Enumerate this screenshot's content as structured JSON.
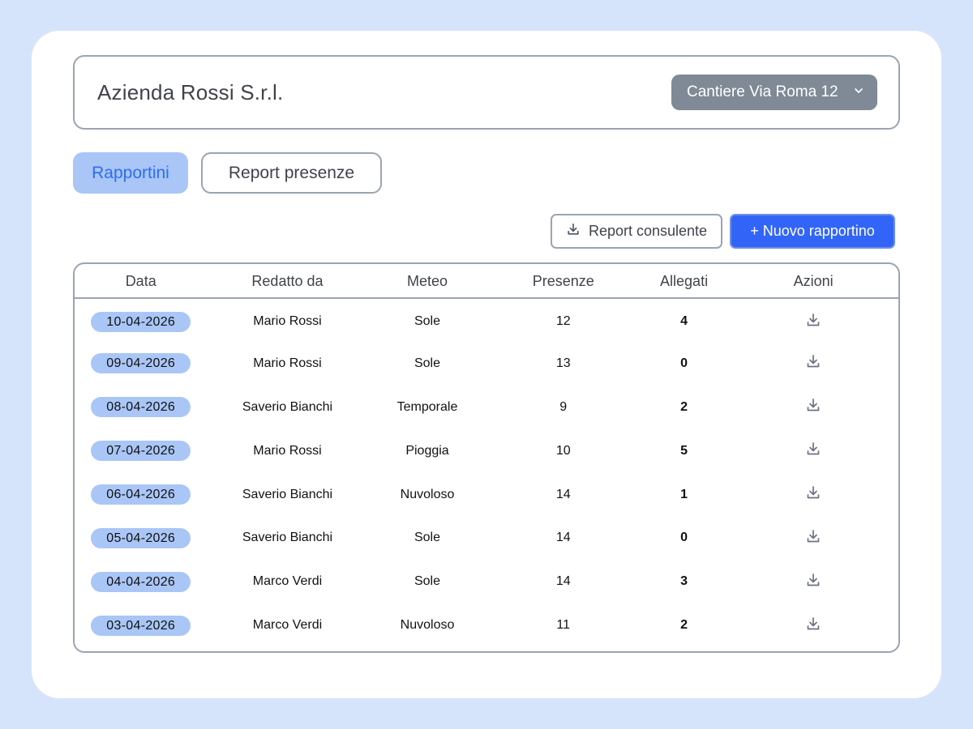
{
  "header": {
    "company_name": "Azienda Rossi S.r.l.",
    "site_selector": {
      "selected": "Cantiere Via Roma 12",
      "icon": "chevron-down-icon"
    }
  },
  "tabs": [
    {
      "label": "Rapportini",
      "active": true
    },
    {
      "label": "Report presenze",
      "active": false
    }
  ],
  "actions": {
    "report_consulente_label": "Report consulente",
    "report_consulente_icon": "download-icon",
    "new_report_label": "+ Nuovo rapportino"
  },
  "table": {
    "columns": [
      "Data",
      "Redatto da",
      "Meteo",
      "Presenze",
      "Allegati",
      "Azioni"
    ],
    "rows": [
      {
        "data": "10-04-2026",
        "redatto_da": "Mario Rossi",
        "meteo": "Sole",
        "presenze": "12",
        "allegati": "4"
      },
      {
        "data": "09-04-2026",
        "redatto_da": "Mario Rossi",
        "meteo": "Sole",
        "presenze": "13",
        "allegati": "0"
      },
      {
        "data": "08-04-2026",
        "redatto_da": "Saverio Bianchi",
        "meteo": "Temporale",
        "presenze": "9",
        "allegati": "2"
      },
      {
        "data": "07-04-2026",
        "redatto_da": "Mario Rossi",
        "meteo": "Pioggia",
        "presenze": "10",
        "allegati": "5"
      },
      {
        "data": "06-04-2026",
        "redatto_da": "Saverio Bianchi",
        "meteo": "Nuvoloso",
        "presenze": "14",
        "allegati": "1"
      },
      {
        "data": "05-04-2026",
        "redatto_da": "Saverio Bianchi",
        "meteo": "Sole",
        "presenze": "14",
        "allegati": "0"
      },
      {
        "data": "04-04-2026",
        "redatto_da": "Marco Verdi",
        "meteo": "Sole",
        "presenze": "14",
        "allegati": "3"
      },
      {
        "data": "03-04-2026",
        "redatto_da": "Marco Verdi",
        "meteo": "Nuvoloso",
        "presenze": "11",
        "allegati": "2"
      }
    ],
    "row_action_icon": "download-icon"
  },
  "colors": {
    "page_background": "#d6e4fb",
    "primary": "#3265f7",
    "tab_active_bg": "#a9c6f6",
    "tab_active_text": "#2f6cf2",
    "select_bg": "#7f8a96",
    "border": "#9ba4b0"
  }
}
